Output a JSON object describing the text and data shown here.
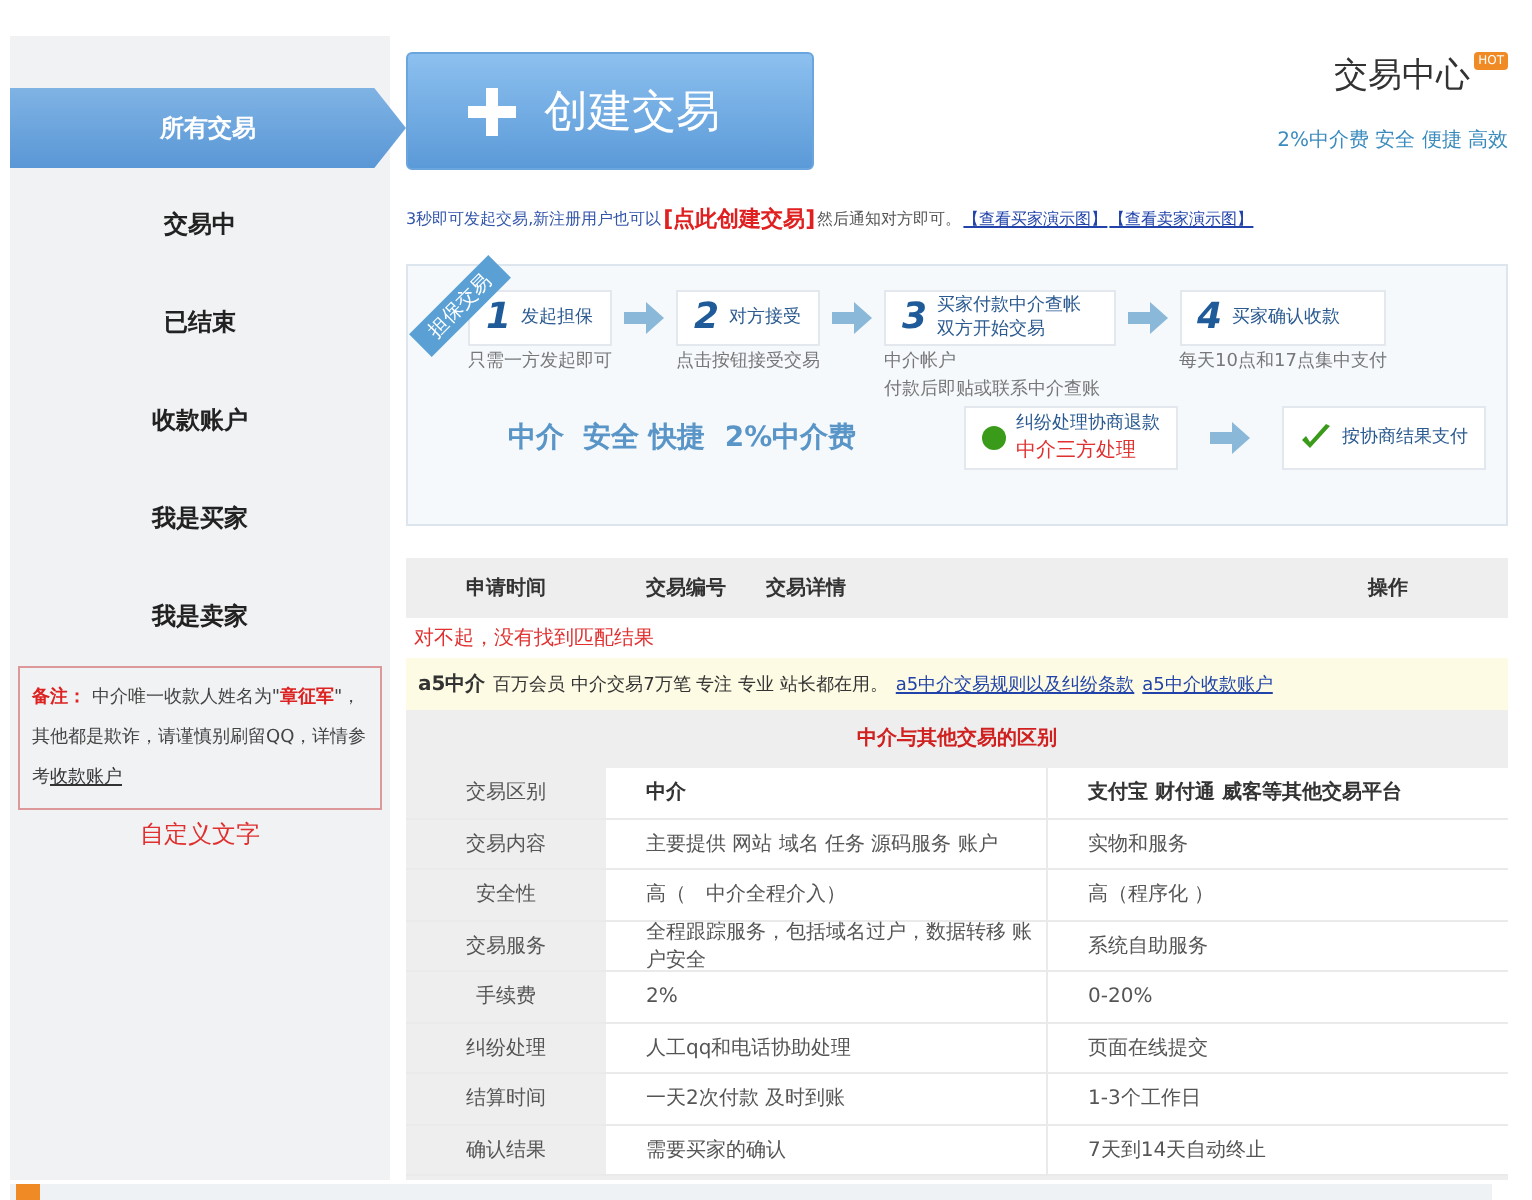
{
  "sidebar": {
    "items": [
      {
        "label": "所有交易",
        "selected": true
      },
      {
        "label": "交易中",
        "selected": false
      },
      {
        "label": "已结束",
        "selected": false
      },
      {
        "label": "收款账户",
        "selected": false
      },
      {
        "label": "我是买家",
        "selected": false
      },
      {
        "label": "我是卖家",
        "selected": false
      }
    ],
    "note": {
      "label": "备注：",
      "text": "中介唯一收款人姓名为\"**章征军**\"，其他都是欺诈，请谨慎别刷留QQ，详情参考",
      "link": "收款账户"
    },
    "custom_text": "自定义文字"
  },
  "create_button": "创建交易",
  "center": {
    "title": "交易中心",
    "badge": "HOT",
    "subtitle": "2%中介费 安全 便捷 高效"
  },
  "intro": {
    "text": "3秒即可发起交易,新注册用户也可以",
    "action": "[点此创建交易]",
    "after": "然后通知对方即可。",
    "links": [
      "【查看买家演示图】",
      "【查看卖家演示图】"
    ]
  },
  "flow": {
    "ribbon": "担保交易",
    "steps": [
      {
        "number": "1",
        "title": "发起担保",
        "caption": [
          "只需一方发起即可"
        ]
      },
      {
        "number": "2",
        "title": "对方接受",
        "caption": [
          "点击按钮接受交易"
        ]
      },
      {
        "number": "3",
        "title": "买家付款中介查帐双方开始交易",
        "caption": [
          "中介帐户",
          "付款后即贴或联系中介查账"
        ]
      },
      {
        "number": "4",
        "title": "买家确认收款",
        "caption": [
          "每天10点和17点集中支付"
        ]
      }
    ],
    "slogan": "中介  安全 快捷  2%中介费",
    "dispute": {
      "title": "纠纷处理协商退款",
      "note": "中介三方处理"
    },
    "result": {
      "title": "按协商结果支付"
    }
  },
  "table": {
    "columns": [
      "申请时间",
      "交易编号",
      "交易详情",
      "操作"
    ],
    "empty_message": "对不起，没有找到匹配结果"
  },
  "notice": {
    "brand": "a5中介",
    "text": "百万会员 中介交易7万笔 专注 专业 站长都在用。",
    "links": [
      "a5中介交易规则以及纠纷条款",
      "a5中介收款账户"
    ]
  },
  "comparison": {
    "title": "中介与其他交易的区别",
    "rows": [
      [
        "交易区别",
        "中介",
        "支付宝 财付通 威客等其他交易平台"
      ],
      [
        "交易内容",
        "主要提供 网站 域名 任务 源码服务 账户",
        "实物和服务"
      ],
      [
        "安全性",
        "高（　中介全程介入）",
        "高（程序化 ）"
      ],
      [
        "交易服务",
        "全程跟踪服务，包括域名过户，数据转移 账户安全",
        "系统自助服务"
      ],
      [
        "手续费",
        "2%",
        "0-20%"
      ],
      [
        "纠纷处理",
        "人工qq和电话协助处理",
        "页面在线提交"
      ],
      [
        "结算时间",
        "一天2次付款 及时到账",
        "1-3个工作日"
      ],
      [
        "确认结果",
        "需要买家的确认",
        "7天到14天自动终止"
      ]
    ]
  }
}
